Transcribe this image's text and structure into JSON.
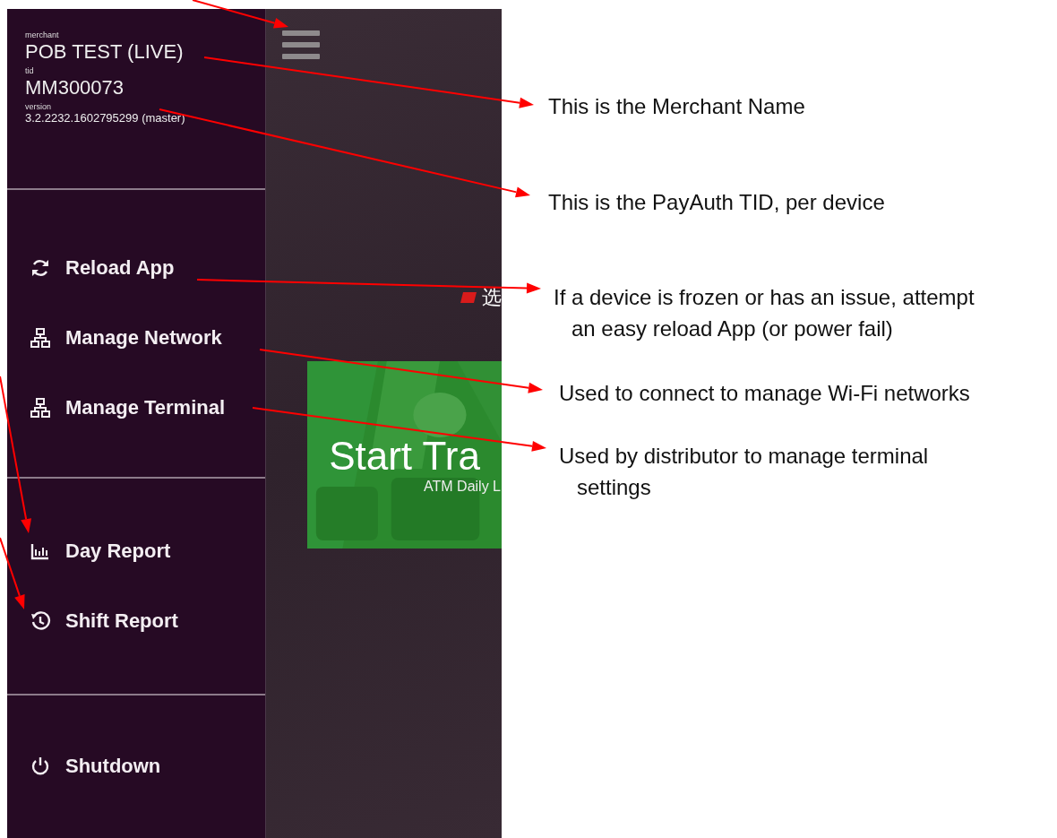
{
  "header": {
    "merchant_label": "merchant",
    "merchant": "POB TEST (LIVE)",
    "tid_label": "tid",
    "tid": "MM300073",
    "version_label": "version",
    "version": "3.2.2232.1602795299 (master)"
  },
  "menu_groups": [
    [
      {
        "kind": "reload",
        "label": "Reload App"
      },
      {
        "kind": "network",
        "label": "Manage Network"
      },
      {
        "kind": "network",
        "label": "Manage Terminal"
      }
    ],
    [
      {
        "kind": "report",
        "label": "Day Report"
      },
      {
        "kind": "history",
        "label": "Shift Report"
      }
    ],
    [
      {
        "kind": "power",
        "label": "Shutdown"
      }
    ]
  ],
  "main": {
    "language_label": "选",
    "card": {
      "title": "Start Tra",
      "subtitle": "ATM Daily L"
    }
  },
  "annotations": [
    {
      "lines": [
        "This is the Merchant Name"
      ]
    },
    {
      "lines": [
        "This is the PayAuth TID, per device"
      ]
    },
    {
      "lines": [
        "If a device is frozen or has an issue, attempt",
        "an easy reload App (or power fail)"
      ]
    },
    {
      "lines": [
        "Used to connect to manage Wi-Fi networks"
      ]
    },
    {
      "lines": [
        "Used by distributor to manage terminal",
        "settings"
      ]
    }
  ]
}
